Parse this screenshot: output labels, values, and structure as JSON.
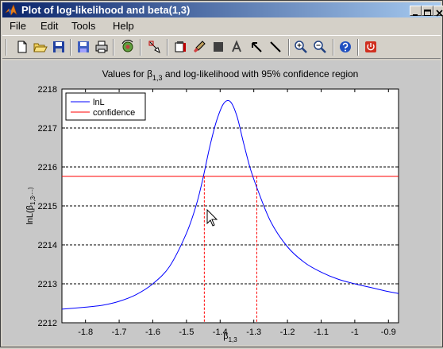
{
  "window": {
    "title": "Plot of log-likelihood and beta(1,3)"
  },
  "menu": [
    "File",
    "Edit",
    "Tools",
    "Help"
  ],
  "toolbar": {
    "buttons": [
      "new-figure",
      "open-file",
      "save",
      "save-as",
      "print",
      "rotate-3d",
      "edit-plot",
      "insert-colorbar",
      "brush",
      "insert-rectangle",
      "insert-text",
      "insert-arrow",
      "insert-line",
      "zoom-in",
      "zoom-out",
      "help",
      "stop"
    ]
  },
  "colors": {
    "lnL": "#0000ff",
    "confidence": "#ff0000",
    "grid": "#000000",
    "titlebar_start": "#0a246a",
    "titlebar_end": "#a6caf0"
  },
  "chart_data": {
    "type": "line",
    "title": "Values for β1,3 and log-likelihood with 95% confidence region",
    "title_main": "Values for β",
    "title_sub": "1,3",
    "title_rest": " and log-likelihood with 95% confidence region",
    "xlabel": "β1,3",
    "xlabel_main": "β",
    "xlabel_sub": "1,3",
    "ylabel": "lnL(β1,3,...)",
    "ylabel_main": "lnL(β",
    "ylabel_sub": "1,3",
    "ylabel_rest": ",...)",
    "xlim": [
      -1.87,
      -0.87
    ],
    "ylim": [
      2212,
      2218
    ],
    "xticks": [
      -1.8,
      -1.7,
      -1.6,
      -1.5,
      -1.4,
      -1.3,
      -1.2,
      -1.1,
      -1,
      -0.9
    ],
    "xtick_labels": [
      "-1.8",
      "-1.7",
      "-1.6",
      "-1.5",
      "-1.4",
      "-1.3",
      "-1.2",
      "-1.1",
      "-1",
      "-0.9"
    ],
    "yticks": [
      2212,
      2213,
      2214,
      2215,
      2216,
      2217,
      2218
    ],
    "ytick_labels": [
      "2212",
      "2213",
      "2214",
      "2215",
      "2216",
      "2217",
      "2218"
    ],
    "grid": "y-dashed",
    "legend_position": "top-left",
    "series": [
      {
        "name": "lnL",
        "x": [
          -1.87,
          -1.8,
          -1.75,
          -1.7,
          -1.65,
          -1.6,
          -1.55,
          -1.5,
          -1.47,
          -1.45,
          -1.43,
          -1.41,
          -1.39,
          -1.37,
          -1.35,
          -1.33,
          -1.31,
          -1.29,
          -1.25,
          -1.2,
          -1.15,
          -1.1,
          -1.05,
          -1.0,
          -0.95,
          -0.9,
          -0.87
        ],
        "y": [
          2212.35,
          2212.4,
          2212.45,
          2212.55,
          2212.72,
          2213.0,
          2213.45,
          2214.3,
          2215.05,
          2215.75,
          2216.55,
          2217.2,
          2217.62,
          2217.68,
          2217.3,
          2216.6,
          2215.95,
          2215.45,
          2214.6,
          2213.95,
          2213.55,
          2213.3,
          2213.12,
          2213.0,
          2212.9,
          2212.8,
          2212.75
        ]
      },
      {
        "name": "confidence",
        "y_level": 2215.76,
        "x_bounds": [
          -1.447,
          -1.291
        ]
      }
    ]
  }
}
